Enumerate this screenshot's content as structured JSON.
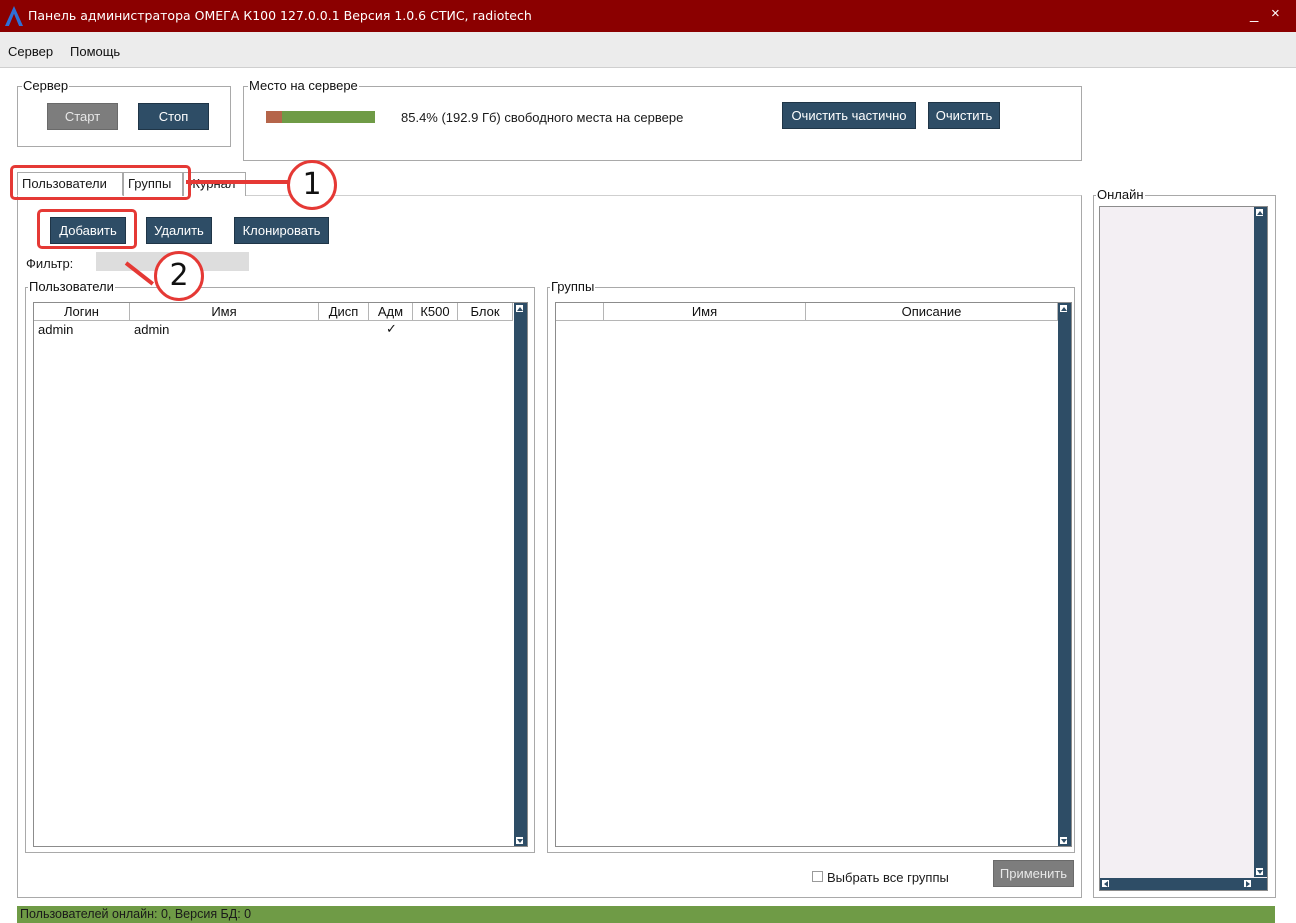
{
  "window": {
    "title": "Панель администратора ОМЕГА К100 127.0.0.1 Версия 1.0.6 СТИС, radiotech",
    "minimize_glyph": "_",
    "close_glyph": "×"
  },
  "menu": [
    "Сервер",
    "Помощь"
  ],
  "server_group": {
    "label": "Сервер",
    "start_label": "Старт",
    "stop_label": "Стоп"
  },
  "space_group": {
    "label": "Место на сервере",
    "used_fraction": 0.146,
    "free_text": "85.4% (192.9 Гб) свободного места на сервере",
    "clear_partial_label": "Очистить частично",
    "clear_label": "Очистить"
  },
  "tabs": [
    "Пользователи",
    "Группы",
    "Журнал"
  ],
  "actions": {
    "add_label": "Добавить",
    "delete_label": "Удалить",
    "clone_label": "Клонировать",
    "filter_label": "Фильтр:",
    "filter_value": ""
  },
  "users_group": {
    "label": "Пользователи",
    "columns": [
      "Логин",
      "Имя",
      "Дисп",
      "Адм",
      "К500",
      "Блок"
    ],
    "rows": [
      {
        "login": "admin",
        "name": "admin",
        "disp": "",
        "adm": "✓",
        "k500": "",
        "block": ""
      }
    ]
  },
  "groups_group": {
    "label": "Группы",
    "columns": [
      "",
      "Имя",
      "Описание"
    ],
    "select_all_label": "Выбрать все группы",
    "select_all_checked": false,
    "apply_label": "Применить"
  },
  "online_group": {
    "label": "Онлайн"
  },
  "status_bar": "Пользователей онлайн: 0, Версия БД: 0",
  "annotations": [
    "1",
    "2"
  ],
  "colors": {
    "titlebar": "#8b0000",
    "button": "#2e4d66",
    "button_disabled": "#7d7d7d",
    "used_space": "#b5654a",
    "free_space": "#6f9b46",
    "status_bar": "#6f9b46",
    "annotation": "#e53935"
  }
}
